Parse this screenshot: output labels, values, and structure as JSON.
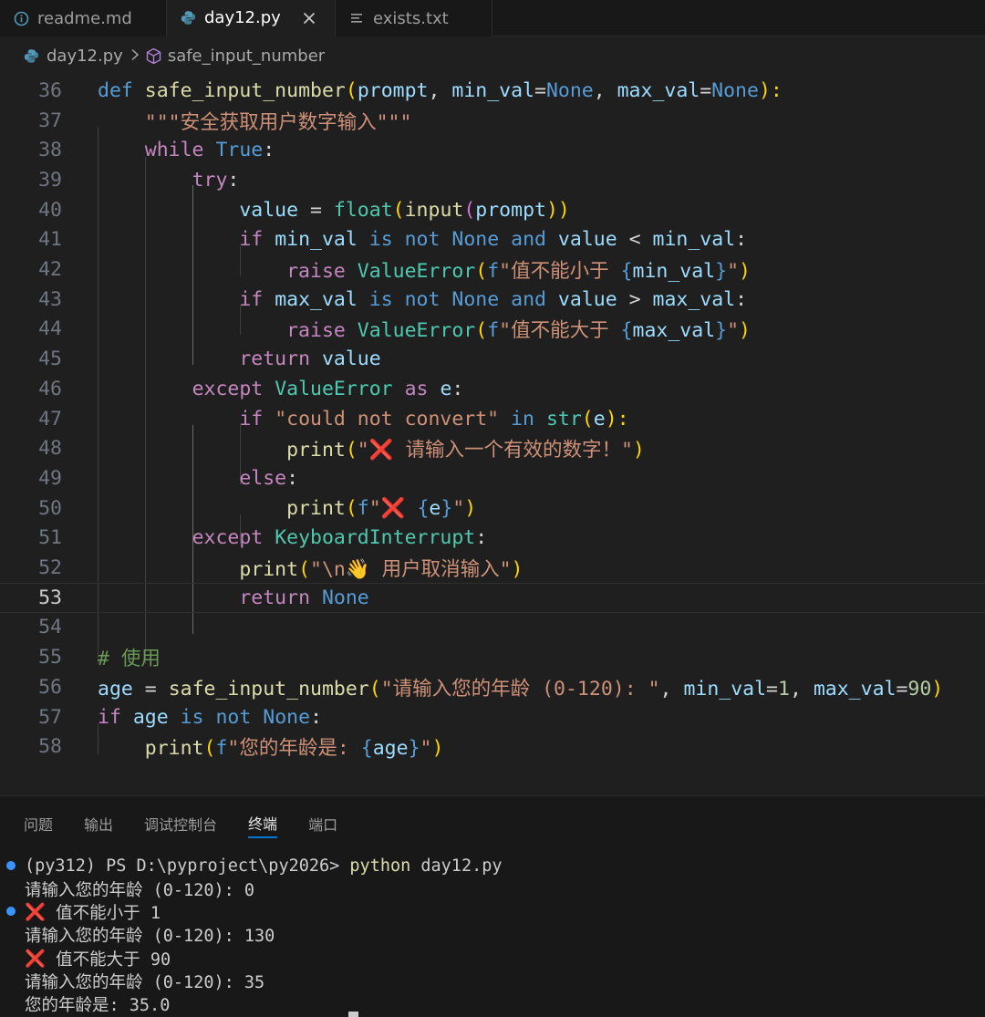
{
  "tabs": [
    {
      "label": "readme.md",
      "icon": "info-icon",
      "active": false
    },
    {
      "label": "day12.py",
      "icon": "python-icon",
      "active": true
    },
    {
      "label": "exists.txt",
      "icon": "text-file-icon",
      "active": false
    }
  ],
  "breadcrumb": {
    "file": "day12.py",
    "symbol": "safe_input_number"
  },
  "editor": {
    "current_line": "53",
    "lines": [
      {
        "n": "36"
      },
      {
        "n": "37"
      },
      {
        "n": "38"
      },
      {
        "n": "39"
      },
      {
        "n": "40"
      },
      {
        "n": "41"
      },
      {
        "n": "42"
      },
      {
        "n": "43"
      },
      {
        "n": "44"
      },
      {
        "n": "45"
      },
      {
        "n": "46"
      },
      {
        "n": "47"
      },
      {
        "n": "48"
      },
      {
        "n": "49"
      },
      {
        "n": "50"
      },
      {
        "n": "51"
      },
      {
        "n": "52"
      },
      {
        "n": "53"
      },
      {
        "n": "54"
      },
      {
        "n": "55"
      },
      {
        "n": "56"
      },
      {
        "n": "57"
      },
      {
        "n": "58"
      }
    ],
    "code": {
      "l36": [
        "def",
        " ",
        "safe_input_number",
        "(",
        "prompt",
        ", ",
        "min_val",
        "=",
        "None",
        ", ",
        "max_val",
        "=",
        "None",
        "):"
      ],
      "l37": [
        "    ",
        "\"\"\"安全获取用户数字输入\"\"\""
      ],
      "l38": [
        "    ",
        "while",
        " ",
        "True",
        ":"
      ],
      "l39": [
        "        ",
        "try",
        ":"
      ],
      "l40": [
        "            ",
        "value",
        " = ",
        "float",
        "(",
        "input",
        "(",
        "prompt",
        "))"
      ],
      "l41": [
        "            ",
        "if",
        " ",
        "min_val",
        " ",
        "is",
        " ",
        "not",
        " ",
        "None",
        " ",
        "and",
        " ",
        "value",
        " < ",
        "min_val",
        ":"
      ],
      "l42": [
        "                ",
        "raise",
        " ",
        "ValueError",
        "(",
        "f",
        "\"值不能小于 ",
        "{",
        "min_val",
        "}",
        "\"",
        ")"
      ],
      "l43": [
        "            ",
        "if",
        " ",
        "max_val",
        " ",
        "is",
        " ",
        "not",
        " ",
        "None",
        " ",
        "and",
        " ",
        "value",
        " > ",
        "max_val",
        ":"
      ],
      "l44": [
        "                ",
        "raise",
        " ",
        "ValueError",
        "(",
        "f",
        "\"值不能大于 ",
        "{",
        "max_val",
        "}",
        "\"",
        ")"
      ],
      "l45": [
        "            ",
        "return",
        " ",
        "value"
      ],
      "l46": [
        "        ",
        "except",
        " ",
        "ValueError",
        " ",
        "as",
        " ",
        "e",
        ":"
      ],
      "l47": [
        "            ",
        "if",
        " ",
        "\"could not convert\"",
        " ",
        "in",
        " ",
        "str",
        "(",
        "e",
        "):"
      ],
      "l48": [
        "                ",
        "print",
        "(",
        "\"",
        "❌",
        " 请输入一个有效的数字！\"",
        ")"
      ],
      "l49": [
        "            ",
        "else",
        ":"
      ],
      "l50": [
        "                ",
        "print",
        "(",
        "f",
        "\"",
        "❌",
        " ",
        "{",
        "e",
        "}",
        "\"",
        ")"
      ],
      "l51": [
        "        ",
        "except",
        " ",
        "KeyboardInterrupt",
        ":"
      ],
      "l52": [
        "            ",
        "print",
        "(",
        "\"\\n",
        "👋",
        " 用户取消输入\"",
        ")"
      ],
      "l53": [
        "            ",
        "return",
        " ",
        "None"
      ],
      "l54": [
        ""
      ],
      "l55": [
        "# 使用"
      ],
      "l56": [
        "age",
        " = ",
        "safe_input_number",
        "(",
        "\"请输入您的年龄 (0-120): \"",
        ", ",
        "min_val",
        "=",
        "1",
        ", ",
        "max_val",
        "=",
        "90",
        ")"
      ],
      "l57": [
        "if",
        " ",
        "age",
        " ",
        "is",
        " ",
        "not",
        " ",
        "None",
        ":"
      ],
      "l58": [
        "    ",
        "print",
        "(",
        "f",
        "\"您的年龄是: ",
        "{",
        "age",
        "}",
        "\"",
        ")"
      ]
    }
  },
  "panel": {
    "tabs": [
      "问题",
      "输出",
      "调试控制台",
      "终端",
      "端口"
    ],
    "active_tab": "终端",
    "terminal": {
      "prompt": "(py312) PS D:\\pyproject\\py2026> ",
      "command": "python",
      "args": " day12.py",
      "out1": "请输入您的年龄 (0-120): 0",
      "err1_icon": "❌",
      "err1": " 值不能小于 1",
      "out2": "请输入您的年龄 (0-120): 130",
      "err2_icon": "❌",
      "err2": " 值不能大于 90",
      "out3": "请输入您的年龄 (0-120): 35",
      "out4": "您的年龄是: 35.0"
    }
  },
  "colors": {
    "keyword": "#569cd6",
    "control": "#c586c0",
    "function": "#dcdcaa",
    "variable": "#9cdcfe",
    "string": "#ce9178",
    "number": "#b5cea8",
    "comment": "#6a9955",
    "type": "#4ec9b0",
    "accent": "#0078d4"
  }
}
